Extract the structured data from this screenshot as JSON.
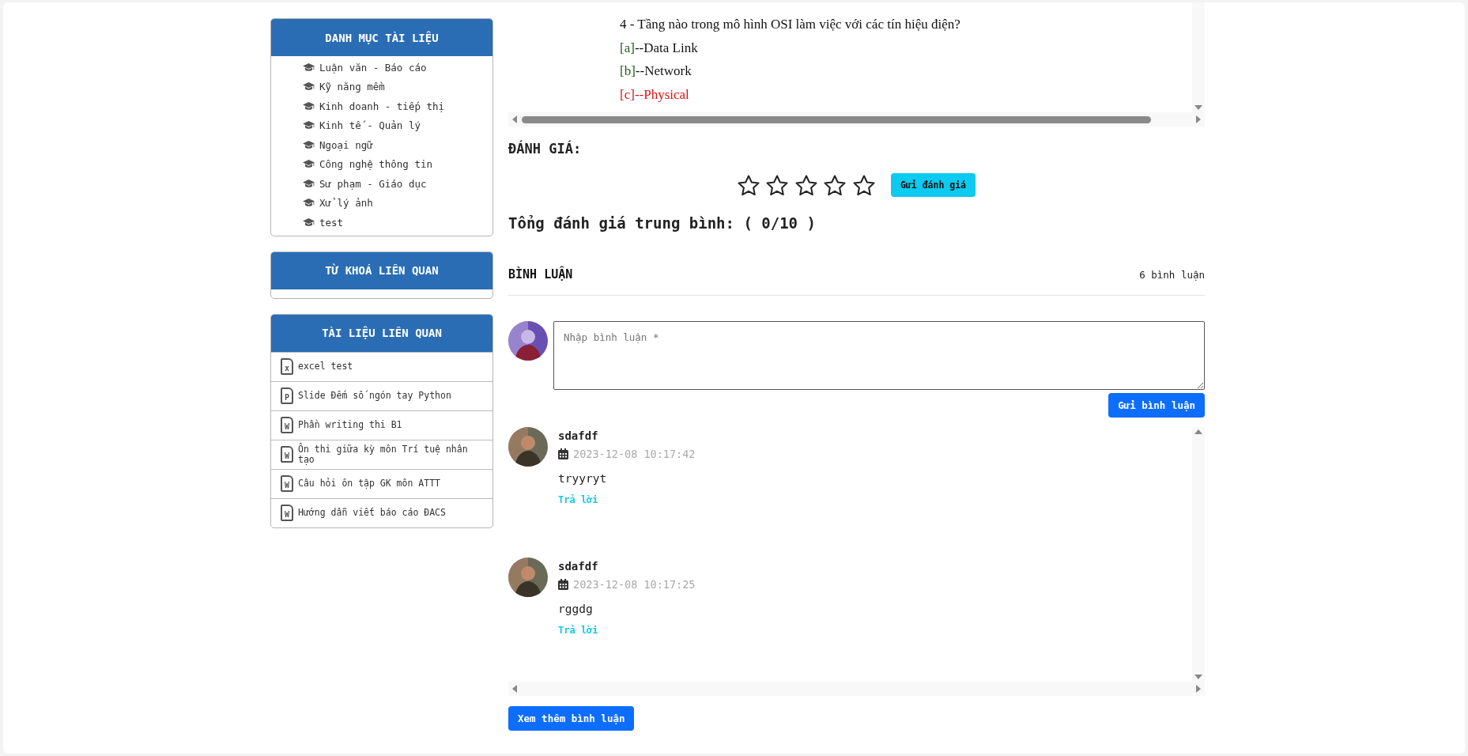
{
  "sidebar": {
    "categories": {
      "title": "DANH MỤC TÀI LIỆU",
      "items": [
        "Luận văn - Báo cáo",
        "Kỹ năng mềm",
        "Kinh doanh - tiếp thị",
        "Kinh tế - Quản lý",
        "Ngoại ngữ",
        "Công nghệ thông tin",
        "Sư phạm - Giáo dục",
        "Xử lý ảnh",
        "test"
      ]
    },
    "keywords": {
      "title": "TỪ KHOÁ LIÊN QUAN"
    },
    "related": {
      "title": "TÀI LIỆU LIÊN QUAN",
      "items": [
        {
          "icon_letter": "x",
          "title": "excel test"
        },
        {
          "icon_letter": "P",
          "title": "Slide Đếm số ngón tay Python"
        },
        {
          "icon_letter": "W",
          "title": "Phần writing thi B1"
        },
        {
          "icon_letter": "W",
          "title": "Ôn thi giữa kỳ môn Trí tuệ nhân tạo"
        },
        {
          "icon_letter": "W",
          "title": "Câu hỏi ôn tập GK môn ATTT"
        },
        {
          "icon_letter": "W",
          "title": "Hướng dẫn viết báo cáo ĐACS"
        }
      ]
    }
  },
  "document": {
    "question": "4 - Tầng nào trong mô hình OSI làm việc với các tín hiệu điện?",
    "options": [
      {
        "label": "[a]",
        "text": "--Data Link",
        "correct": false
      },
      {
        "label": "[b]",
        "text": "--Network",
        "correct": false
      },
      {
        "label": "[c]",
        "text": "--Physical",
        "correct": true
      }
    ]
  },
  "rating": {
    "title": "ĐÁNH GIÁ:",
    "stars": 0,
    "submit": "Gửi đánh giá",
    "average": "Tổng đánh giá trung bình: ( 0/10 )"
  },
  "comments": {
    "title": "BÌNH LUẬN",
    "count": "6 bình luận",
    "placeholder": "Nhập bình luận *",
    "submit": "Gửi bình luận",
    "items": [
      {
        "author": "sdafdf",
        "date": "2023-12-08 10:17:42",
        "text": "tryyryt",
        "reply": "Trả lời"
      },
      {
        "author": "sdafdf",
        "date": "2023-12-08 10:17:25",
        "text": "rggdg",
        "reply": "Trả lời"
      }
    ],
    "more": "Xem thêm bình luận"
  }
}
